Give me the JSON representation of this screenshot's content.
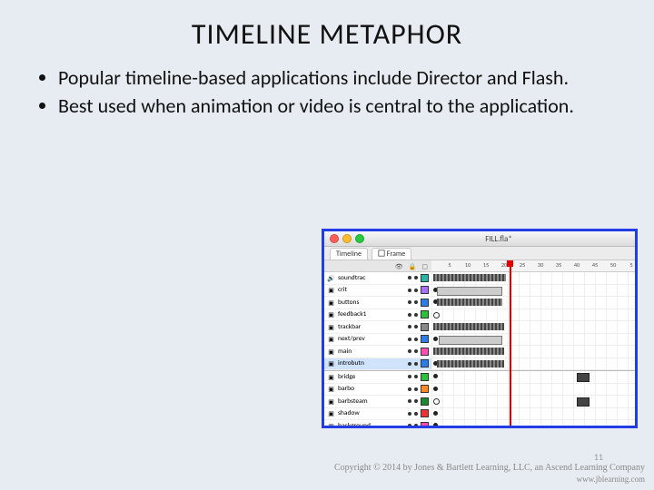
{
  "title": "TIMELINE METAPHOR",
  "bullets": [
    "Popular timeline-based applications include Director and Flash.",
    "Best used when animation or video is central to the application."
  ],
  "figure": {
    "window_title": "FILL.fla*",
    "tabs": [
      "Timeline",
      "Frame"
    ],
    "ruler_marks": [
      "5",
      "10",
      "15",
      "20",
      "25",
      "30",
      "35",
      "40",
      "45",
      "50",
      "5"
    ],
    "playhead_frame": 20,
    "layer_header_icons": [
      "eye",
      "lock",
      "outline"
    ],
    "layers_top": [
      {
        "name": "soundtrac",
        "icon": "audio",
        "col": "teal"
      },
      {
        "name": "crit",
        "icon": "layer",
        "col": "purple"
      },
      {
        "name": "buttons",
        "icon": "layer",
        "col": "blue"
      },
      {
        "name": "feedback1",
        "icon": "layer",
        "col": "green"
      },
      {
        "name": "trackbar",
        "icon": "layer",
        "col": "gray"
      },
      {
        "name": "next/prev",
        "icon": "layer",
        "col": "blue"
      },
      {
        "name": "main",
        "icon": "layer",
        "col": "pink"
      },
      {
        "name": "introbutn",
        "icon": "layer",
        "col": "blue",
        "selected": true
      }
    ],
    "layers_bottom": [
      {
        "name": "bridge",
        "icon": "layer",
        "col": "green"
      },
      {
        "name": "barbo",
        "icon": "layer",
        "col": "orange"
      },
      {
        "name": "barbsteam",
        "icon": "layer",
        "col": "dkgreen"
      },
      {
        "name": "shadow",
        "icon": "layer",
        "col": "red"
      },
      {
        "name": "background",
        "icon": "layer",
        "col": "pink"
      }
    ]
  },
  "page_number": "11",
  "copyright_line1": "Copyright © 2014 by Jones & Bartlett Learning, LLC, an Ascend Learning Company",
  "copyright_line2": "www.jblearning.com"
}
